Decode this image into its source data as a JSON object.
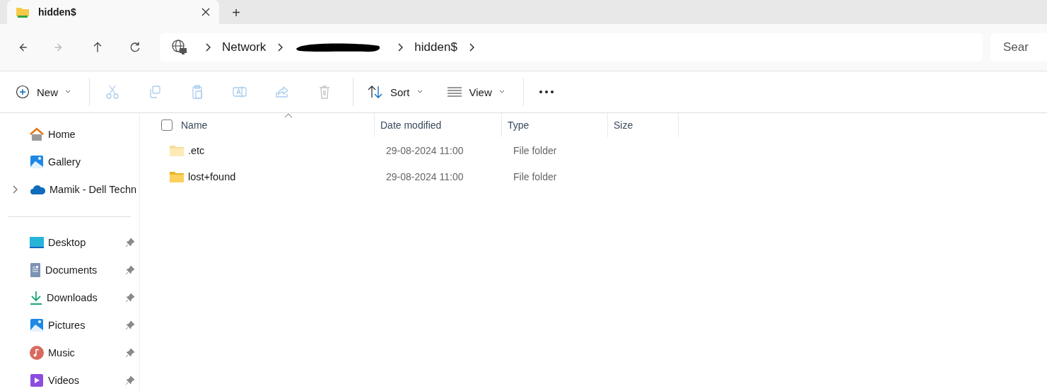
{
  "tabs": [
    {
      "label": "hidden$",
      "selected": true
    }
  ],
  "new_tab": "+",
  "nav": [
    {
      "disabled": false
    },
    {
      "disabled": true
    },
    {
      "disabled": false
    },
    {
      "disabled": false
    }
  ],
  "breadcrumbs": [
    {
      "kind": "text",
      "label": "Network"
    },
    {
      "kind": "redacted"
    },
    {
      "kind": "text",
      "label": "hidden$"
    }
  ],
  "search": {
    "placeholder": "Sear"
  },
  "toolbar": {
    "new": {
      "label": "New"
    },
    "actions": [
      {
        "disabled": true
      },
      {
        "disabled": true
      },
      {
        "disabled": true
      },
      {
        "disabled": true
      },
      {
        "disabled": true
      },
      {
        "disabled": true
      }
    ],
    "sort": {
      "label": "Sort"
    },
    "view": {
      "label": "View"
    }
  },
  "sidebar": {
    "groups": [
      {
        "items": [
          {
            "label": "Home",
            "expander": false,
            "pinned": false
          },
          {
            "label": "Gallery",
            "expander": false,
            "pinned": false
          },
          {
            "label": "Mamik - Dell Techn",
            "expander": true,
            "pinned": false
          }
        ]
      },
      {
        "items": [
          {
            "label": "Desktop",
            "expander": false,
            "pinned": true
          },
          {
            "label": "Documents",
            "expander": false,
            "pinned": true
          },
          {
            "label": "Downloads",
            "expander": false,
            "pinned": true
          },
          {
            "label": "Pictures",
            "expander": false,
            "pinned": true
          },
          {
            "label": "Music",
            "expander": false,
            "pinned": true
          },
          {
            "label": "Videos",
            "expander": false,
            "pinned": true
          }
        ]
      }
    ]
  },
  "table": {
    "select_all": {
      "checked": false
    },
    "columns": [
      {
        "label": "Name",
        "sorted": true
      },
      {
        "label": "Date modified",
        "sorted": false
      },
      {
        "label": "Type",
        "sorted": false
      },
      {
        "label": "Size",
        "sorted": false
      }
    ],
    "rows": [
      {
        "name": ".etc",
        "date": "29-08-2024 11:00",
        "type": "File folder",
        "hidden": true
      },
      {
        "name": "lost+found",
        "date": "29-08-2024 11:00",
        "type": "File folder",
        "hidden": false
      }
    ]
  }
}
